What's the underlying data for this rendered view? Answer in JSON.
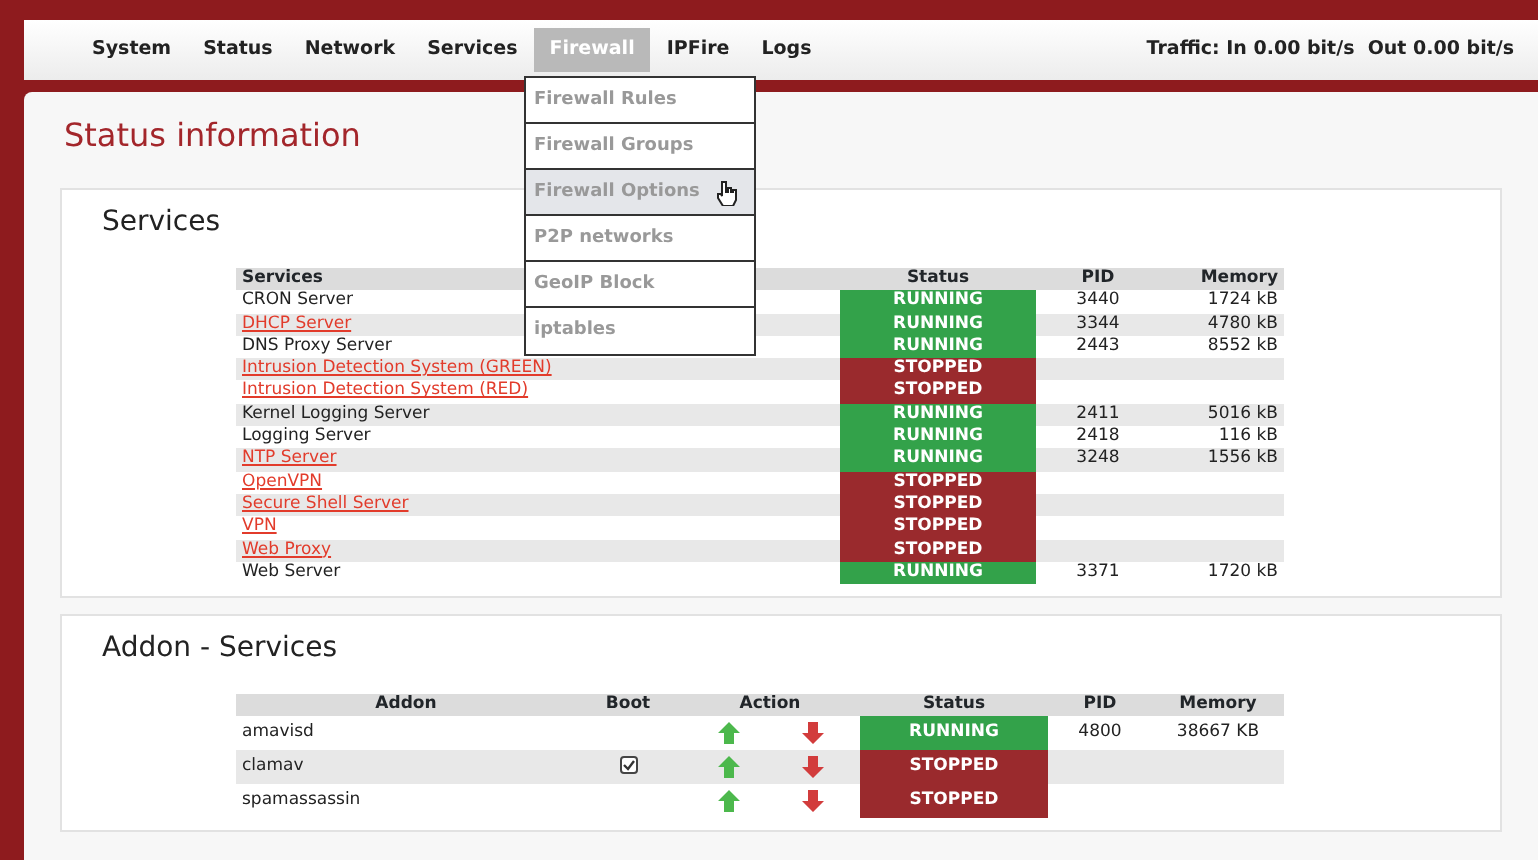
{
  "nav": {
    "items": [
      {
        "label": "System",
        "selected": false
      },
      {
        "label": "Status",
        "selected": false
      },
      {
        "label": "Network",
        "selected": false
      },
      {
        "label": "Services",
        "selected": false
      },
      {
        "label": "Firewall",
        "selected": true
      },
      {
        "label": "IPFire",
        "selected": false
      },
      {
        "label": "Logs",
        "selected": false
      }
    ],
    "traffic": "Traffic: In 0.00 bit/s  Out 0.00 bit/s"
  },
  "dropdown": {
    "items": [
      {
        "label": "Firewall Rules",
        "selected": false
      },
      {
        "label": "Firewall Groups",
        "selected": false
      },
      {
        "label": "Firewall Options",
        "selected": true
      },
      {
        "label": "P2P networks",
        "selected": false
      },
      {
        "label": "GeoIP Block",
        "selected": false
      },
      {
        "label": "iptables",
        "selected": false
      }
    ]
  },
  "page_title": "Status information",
  "services": {
    "title": "Services",
    "columns": [
      "Services",
      "Status",
      "PID",
      "Memory"
    ],
    "rows": [
      {
        "name": "CRON Server",
        "link": false,
        "status": "RUNNING",
        "running": true,
        "pid": "3440",
        "memory": "1724 kB"
      },
      {
        "name": "DHCP Server",
        "link": true,
        "status": "RUNNING",
        "running": true,
        "pid": "3344",
        "memory": "4780 kB"
      },
      {
        "name": "DNS Proxy Server",
        "link": false,
        "status": "RUNNING",
        "running": true,
        "pid": "2443",
        "memory": "8552 kB"
      },
      {
        "name": "Intrusion Detection System (GREEN)",
        "link": true,
        "status": "STOPPED",
        "running": false
      },
      {
        "name": "Intrusion Detection System (RED)",
        "link": true,
        "status": "STOPPED",
        "running": false
      },
      {
        "name": "Kernel Logging Server",
        "link": false,
        "status": "RUNNING",
        "running": true,
        "pid": "2411",
        "memory": "5016 kB"
      },
      {
        "name": "Logging Server",
        "link": false,
        "status": "RUNNING",
        "running": true,
        "pid": "2418",
        "memory": "116 kB"
      },
      {
        "name": "NTP Server",
        "link": true,
        "status": "RUNNING",
        "running": true,
        "pid": "3248",
        "memory": "1556 kB"
      },
      {
        "name": "OpenVPN",
        "link": true,
        "status": "STOPPED",
        "running": false
      },
      {
        "name": "Secure Shell Server",
        "link": true,
        "status": "STOPPED",
        "running": false
      },
      {
        "name": "VPN",
        "link": true,
        "status": "STOPPED",
        "running": false
      },
      {
        "name": "Web Proxy",
        "link": true,
        "status": "STOPPED",
        "running": false
      },
      {
        "name": "Web Server",
        "link": false,
        "status": "RUNNING",
        "running": true,
        "pid": "3371",
        "memory": "1720 kB"
      }
    ]
  },
  "addons": {
    "title": "Addon - Services",
    "columns": [
      "Addon",
      "Boot",
      "Action",
      "Status",
      "PID",
      "Memory"
    ],
    "rows": [
      {
        "name": "amavisd",
        "boot": false,
        "status": "RUNNING",
        "running": true,
        "pid": "4800",
        "memory": "38667 KB"
      },
      {
        "name": "clamav",
        "boot": true,
        "status": "STOPPED",
        "running": false
      },
      {
        "name": "spamassassin",
        "boot": false,
        "status": "STOPPED",
        "running": false
      }
    ]
  }
}
